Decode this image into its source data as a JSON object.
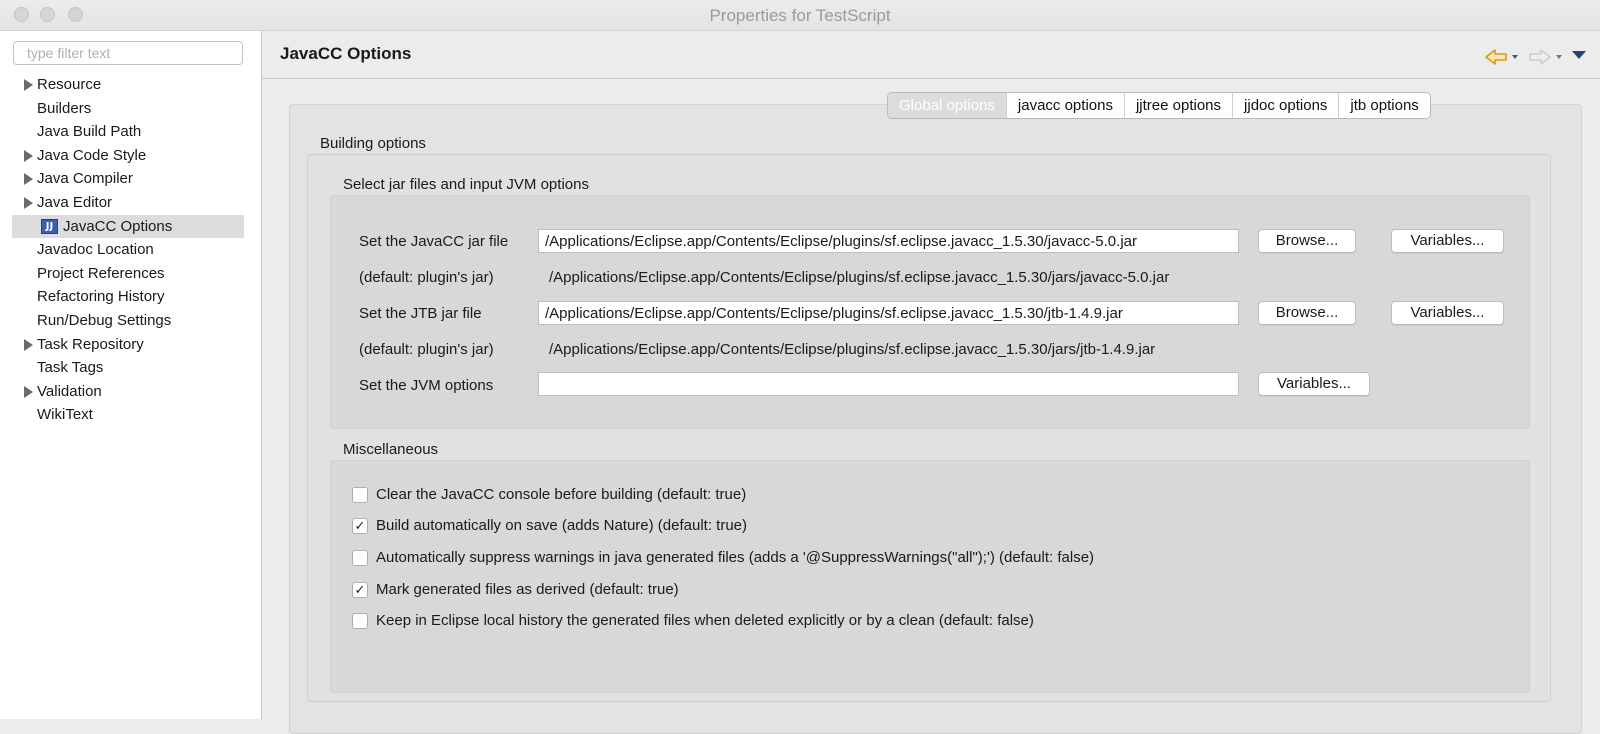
{
  "window": {
    "title": "Properties for TestScript"
  },
  "sidebar": {
    "filter_placeholder": "type filter text",
    "items": [
      {
        "label": "Resource",
        "expandable": true
      },
      {
        "label": "Builders",
        "expandable": false
      },
      {
        "label": "Java Build Path",
        "expandable": false
      },
      {
        "label": "Java Code Style",
        "expandable": true
      },
      {
        "label": "Java Compiler",
        "expandable": true
      },
      {
        "label": "Java Editor",
        "expandable": true
      },
      {
        "label": "JavaCC Options",
        "expandable": false,
        "selected": true,
        "icon": "javacc-jj-icon",
        "icon_text": "JJ"
      },
      {
        "label": "Javadoc Location",
        "expandable": false
      },
      {
        "label": "Project References",
        "expandable": false
      },
      {
        "label": "Refactoring History",
        "expandable": false
      },
      {
        "label": "Run/Debug Settings",
        "expandable": false
      },
      {
        "label": "Task Repository",
        "expandable": true
      },
      {
        "label": "Task Tags",
        "expandable": false
      },
      {
        "label": "Validation",
        "expandable": true
      },
      {
        "label": "WikiText",
        "expandable": false
      }
    ]
  },
  "page": {
    "title": "JavaCC Options",
    "nav": {
      "back_icon": "back-arrow-icon",
      "forward_icon": "forward-arrow-icon",
      "menu_icon": "view-menu-icon"
    }
  },
  "tabs": [
    "Global options",
    "javacc options",
    "jjtree options",
    "jjdoc options",
    "jtb options"
  ],
  "active_tab": "Global options",
  "building": {
    "title": "Building options",
    "jars": {
      "title": "Select jar files and input JVM options",
      "javacc_label": "Set the JavaCC jar file",
      "javacc_value": "/Applications/Eclipse.app/Contents/Eclipse/plugins/sf.eclipse.javacc_1.5.30/javacc-5.0.jar",
      "javacc_default_label": "(default: plugin's jar)",
      "javacc_default_value": "/Applications/Eclipse.app/Contents/Eclipse/plugins/sf.eclipse.javacc_1.5.30/jars/javacc-5.0.jar",
      "jtb_label": "Set the JTB jar file",
      "jtb_value": "/Applications/Eclipse.app/Contents/Eclipse/plugins/sf.eclipse.javacc_1.5.30/jtb-1.4.9.jar",
      "jtb_default_label": "(default: plugin's jar)",
      "jtb_default_value": "/Applications/Eclipse.app/Contents/Eclipse/plugins/sf.eclipse.javacc_1.5.30/jars/jtb-1.4.9.jar",
      "jvm_label": "Set the JVM options",
      "jvm_value": "",
      "browse": "Browse...",
      "variables": "Variables..."
    }
  },
  "misc": {
    "title": "Miscellaneous",
    "options": [
      {
        "label": "Clear the JavaCC console before building (default:  true)",
        "checked": false
      },
      {
        "label": "Build automatically on save (adds Nature) (default:  true)",
        "checked": true
      },
      {
        "label": "Automatically suppress warnings in java generated files (adds a '@SuppressWarnings(\"all\");') (default:  false)",
        "checked": false
      },
      {
        "label": "Mark generated files as derived (default:  true)",
        "checked": true
      },
      {
        "label": "Keep in Eclipse local history the generated files when deleted explicitly or by a clean (default:  false)",
        "checked": false
      }
    ]
  },
  "colors": {
    "nav_back_accent": "#e0a020",
    "nav_disabled": "#cfcfcf",
    "selection": "#dcdcdc"
  }
}
